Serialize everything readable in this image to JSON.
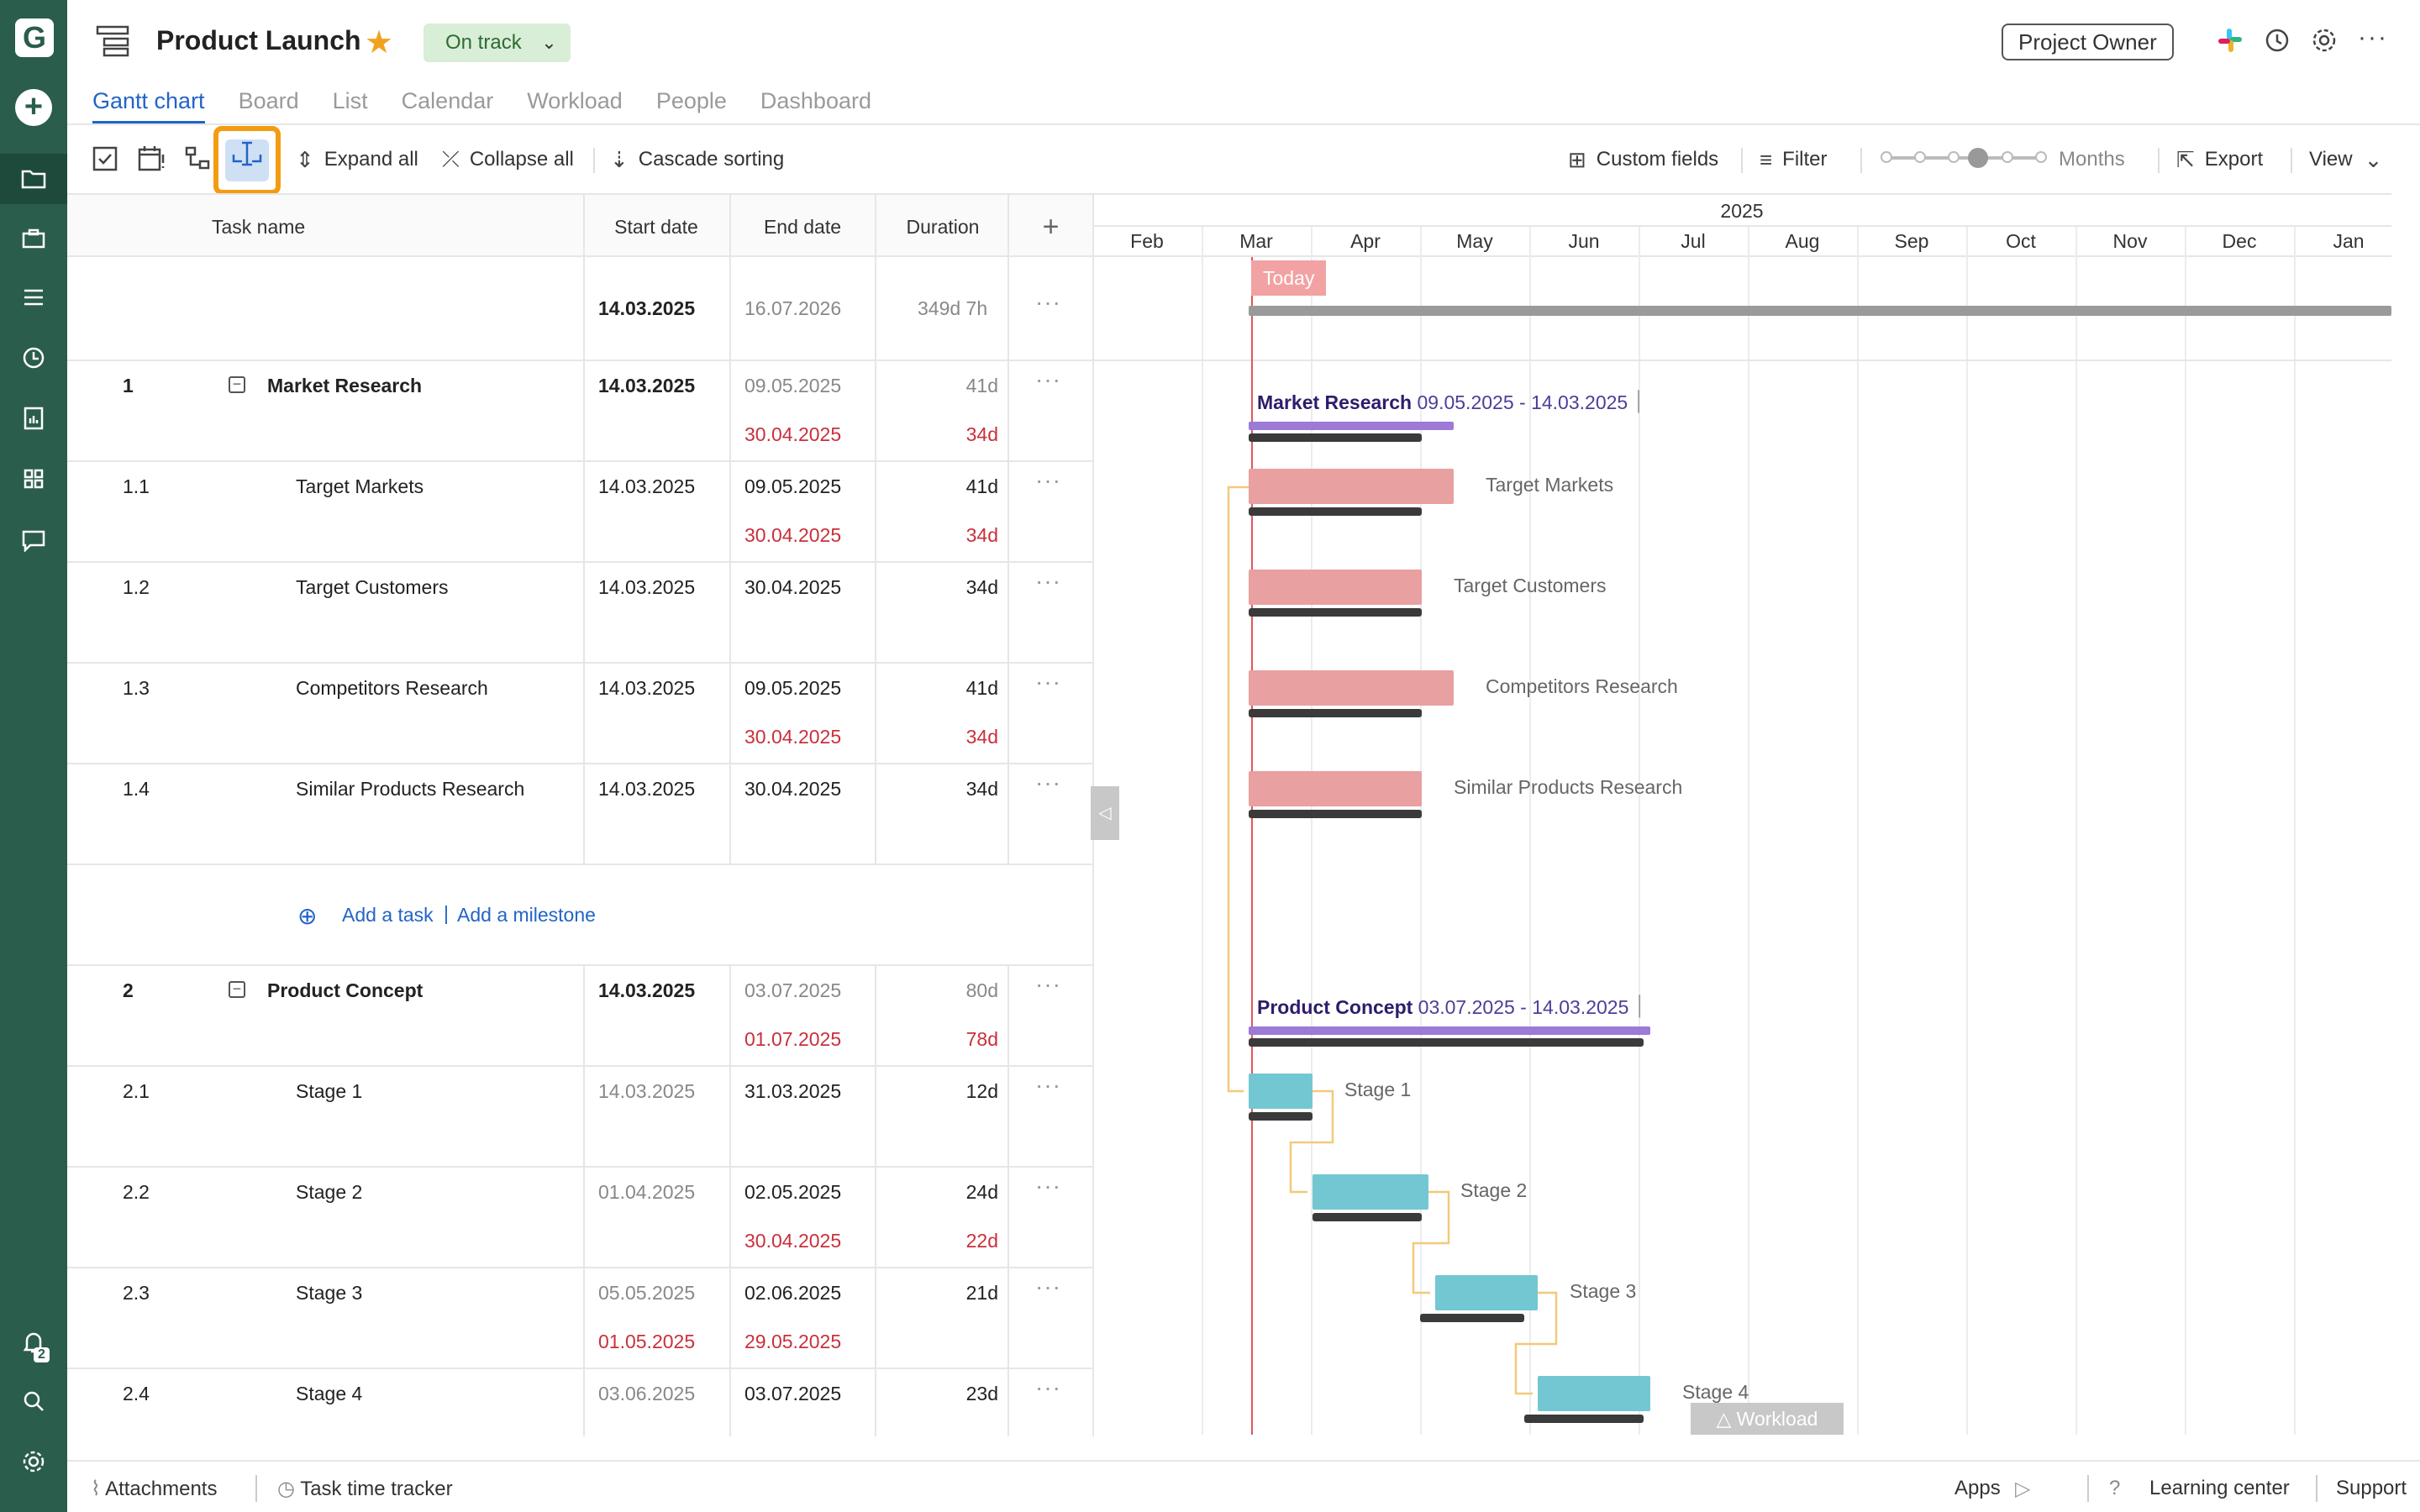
{
  "header": {
    "title": "Product Launch",
    "status": "On track",
    "owner_button": "Project Owner"
  },
  "tabs": [
    "Gantt chart",
    "Board",
    "List",
    "Calendar",
    "Workload",
    "People",
    "Dashboard"
  ],
  "toolbar": {
    "expand_all": "Expand all",
    "collapse_all": "Collapse all",
    "cascade_sorting": "Cascade sorting",
    "custom_fields": "Custom fields",
    "filter": "Filter",
    "zoom_label": "Months",
    "export": "Export",
    "view": "View"
  },
  "grid": {
    "columns": [
      "Task name",
      "Start date",
      "End date",
      "Duration"
    ],
    "project_row": {
      "start": "14.03.2025",
      "end": "16.07.2026",
      "duration": "349d 7h"
    },
    "rows": [
      {
        "num": "1",
        "name": "Market Research",
        "start": "14.03.2025",
        "end": "09.05.2025",
        "duration": "41d",
        "base_end": "30.04.2025",
        "base_dur": "34d"
      },
      {
        "num": "1.1",
        "name": "Target Markets",
        "start": "14.03.2025",
        "end": "09.05.2025",
        "duration": "41d",
        "base_end": "30.04.2025",
        "base_dur": "34d"
      },
      {
        "num": "1.2",
        "name": "Target Customers",
        "start": "14.03.2025",
        "end": "30.04.2025",
        "duration": "34d"
      },
      {
        "num": "1.3",
        "name": "Competitors Research",
        "start": "14.03.2025",
        "end": "09.05.2025",
        "duration": "41d",
        "base_end": "30.04.2025",
        "base_dur": "34d"
      },
      {
        "num": "1.4",
        "name": "Similar Products Research",
        "start": "14.03.2025",
        "end": "30.04.2025",
        "duration": "34d"
      },
      {
        "num": "2",
        "name": "Product Concept",
        "start": "14.03.2025",
        "end": "03.07.2025",
        "duration": "80d",
        "base_end": "01.07.2025",
        "base_dur": "78d"
      },
      {
        "num": "2.1",
        "name": "Stage 1",
        "start": "14.03.2025",
        "end": "31.03.2025",
        "duration": "12d"
      },
      {
        "num": "2.2",
        "name": "Stage 2",
        "start": "01.04.2025",
        "end": "02.05.2025",
        "duration": "24d",
        "base_end": "30.04.2025",
        "base_dur": "22d"
      },
      {
        "num": "2.3",
        "name": "Stage 3",
        "start": "05.05.2025",
        "end": "02.06.2025",
        "duration": "21d",
        "base_start": "01.05.2025",
        "base_end": "29.05.2025"
      },
      {
        "num": "2.4",
        "name": "Stage 4",
        "start": "03.06.2025",
        "end": "03.07.2025",
        "duration": "23d"
      }
    ],
    "add_task": "Add a task",
    "add_milestone": "Add a milestone"
  },
  "chart": {
    "year": "2025",
    "months": [
      "Feb",
      "Mar",
      "Apr",
      "May",
      "Jun",
      "Jul",
      "Aug",
      "Sep",
      "Oct",
      "Nov",
      "Dec",
      "Jan"
    ],
    "today": "Today",
    "group1_label": "Market Research",
    "group1_range": "14.03.2025 - 09.05.2025",
    "group2_label": "Product Concept",
    "group2_range": "14.03.2025 - 03.07.2025",
    "bar_labels": [
      "Target Markets",
      "Target Customers",
      "Competitors Research",
      "Similar Products Research",
      "Stage 1",
      "Stage 2",
      "Stage 3",
      "Stage 4"
    ],
    "workload_tab": "Workload"
  },
  "footer": {
    "attachments": "Attachments",
    "time_tracker": "Task time tracker",
    "apps": "Apps",
    "learning_center": "Learning center",
    "support": "Support"
  },
  "rail": {
    "notification_count": "2"
  },
  "colors": {
    "rail": "#2a5d4b",
    "accent": "#2264c7",
    "highlight": "#f39c12",
    "task_bar": "#e8a0a0",
    "stage_bar": "#73c7d2",
    "group_bar": "#9c7ad6",
    "today": "#e0575e"
  }
}
